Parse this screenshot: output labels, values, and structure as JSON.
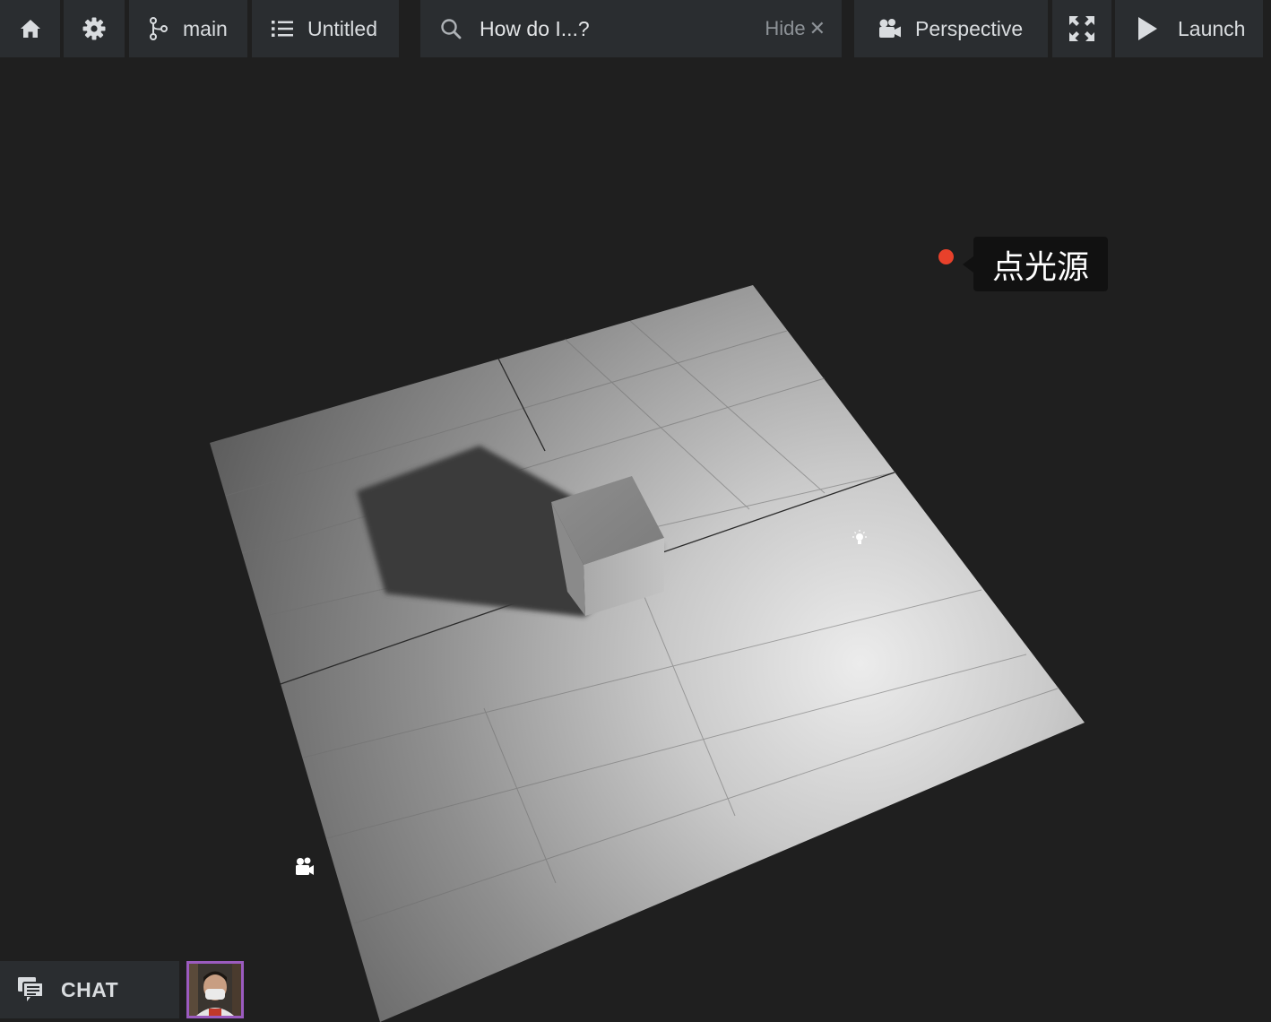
{
  "toolbar": {
    "home_icon": "home-icon",
    "settings_icon": "gear-icon",
    "branch": {
      "icon": "git-branch-icon",
      "label": "main"
    },
    "scene": {
      "icon": "list-icon",
      "label": "Untitled"
    },
    "search": {
      "icon": "search-icon",
      "text": "How do I...?",
      "hide_label": "Hide",
      "hide_icon": "close-icon"
    },
    "camera": {
      "icon": "video-camera-icon",
      "label": "Perspective"
    },
    "fullscreen_icon": "fullscreen-icon",
    "launch": {
      "icon": "play-icon",
      "label": "Launch"
    }
  },
  "viewport": {
    "selected_object": {
      "label": "点光源",
      "marker_color": "#e8412b"
    },
    "gizmos": [
      "light-bulb-icon",
      "camera-icon"
    ]
  },
  "chat": {
    "icon": "chat-icon",
    "label": "CHAT"
  },
  "user": {
    "avatar": "user-avatar",
    "avatar_border_color": "#9b5bbf"
  }
}
